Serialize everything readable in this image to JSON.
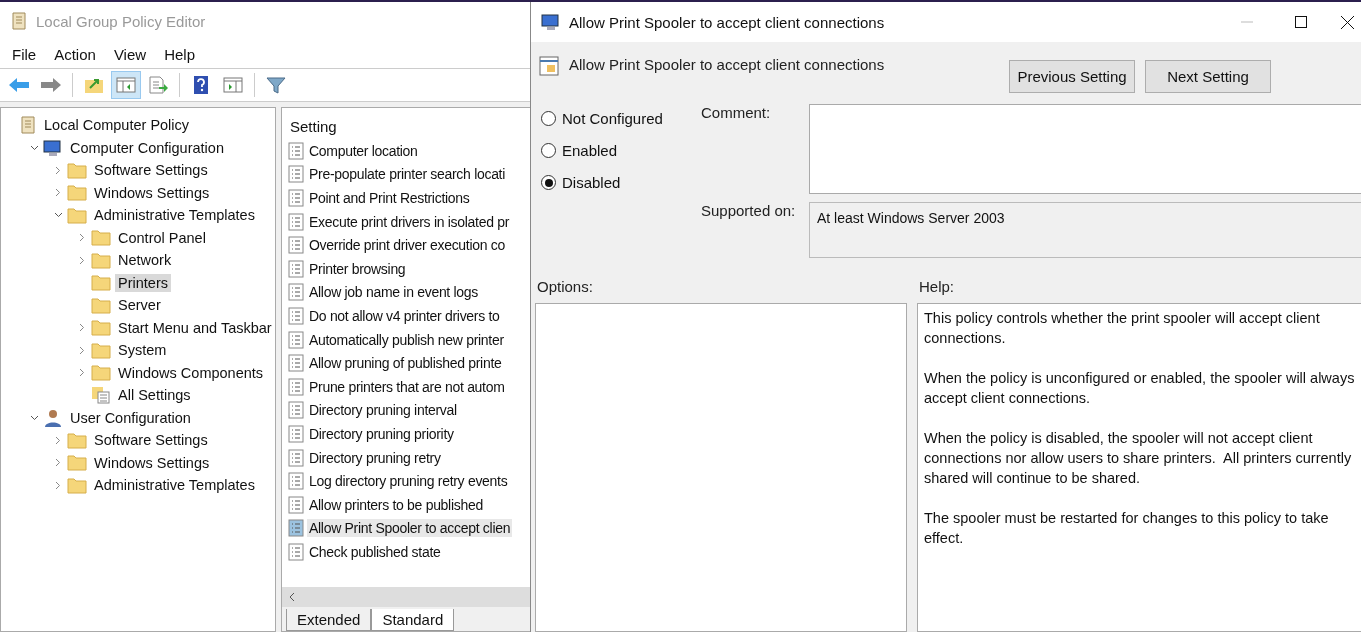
{
  "main_window": {
    "title": "Local Group Policy Editor",
    "menu": [
      "File",
      "Action",
      "View",
      "Help"
    ],
    "toolbar": [
      {
        "kind": "back",
        "selected": false
      },
      {
        "kind": "forward",
        "selected": false
      },
      {
        "kind": "sep"
      },
      {
        "kind": "up",
        "selected": false
      },
      {
        "kind": "tree",
        "selected": true
      },
      {
        "kind": "export",
        "selected": false
      },
      {
        "kind": "sep"
      },
      {
        "kind": "help",
        "selected": false
      },
      {
        "kind": "pane",
        "selected": false
      },
      {
        "kind": "sep"
      },
      {
        "kind": "filter",
        "selected": false
      }
    ],
    "tree": [
      {
        "label": "Local Computer Policy",
        "kind": "policy",
        "selected": false,
        "children": [
          {
            "label": "Computer Configuration",
            "kind": "computer",
            "expanded": true,
            "selected": false,
            "children": [
              {
                "label": "Software Settings",
                "kind": "folder",
                "expanded": false,
                "selected": false
              },
              {
                "label": "Windows Settings",
                "kind": "folder",
                "expanded": false,
                "selected": false
              },
              {
                "label": "Administrative Templates",
                "kind": "folder",
                "expanded": true,
                "selected": false,
                "children": [
                  {
                    "label": "Control Panel",
                    "kind": "folder",
                    "expanded": false,
                    "selected": false
                  },
                  {
                    "label": "Network",
                    "kind": "folder",
                    "expanded": false,
                    "selected": false
                  },
                  {
                    "label": "Printers",
                    "kind": "folder",
                    "selected": true
                  },
                  {
                    "label": "Server",
                    "kind": "folder",
                    "selected": false
                  },
                  {
                    "label": "Start Menu and Taskbar",
                    "kind": "folder",
                    "expanded": false,
                    "selected": false
                  },
                  {
                    "label": "System",
                    "kind": "folder",
                    "expanded": false,
                    "selected": false
                  },
                  {
                    "label": "Windows Components",
                    "kind": "folder",
                    "expanded": false,
                    "selected": false
                  },
                  {
                    "label": "All Settings",
                    "kind": "settings",
                    "selected": false
                  }
                ]
              }
            ]
          },
          {
            "label": "User Configuration",
            "kind": "user",
            "expanded": true,
            "selected": false,
            "children": [
              {
                "label": "Software Settings",
                "kind": "folder",
                "expanded": false,
                "selected": false
              },
              {
                "label": "Windows Settings",
                "kind": "folder",
                "expanded": false,
                "selected": false
              },
              {
                "label": "Administrative Templates",
                "kind": "folder",
                "expanded": false,
                "selected": false
              }
            ]
          }
        ]
      }
    ],
    "list": {
      "column": "Setting",
      "rows": [
        {
          "label": "Computer location",
          "selected": false
        },
        {
          "label": "Pre-populate printer search locati",
          "selected": false
        },
        {
          "label": "Point and Print Restrictions",
          "selected": false
        },
        {
          "label": "Execute print drivers in isolated pr",
          "selected": false
        },
        {
          "label": "Override print driver execution co",
          "selected": false
        },
        {
          "label": "Printer browsing",
          "selected": false
        },
        {
          "label": "Allow job name in event logs",
          "selected": false
        },
        {
          "label": "Do not allow v4 printer drivers to",
          "selected": false
        },
        {
          "label": "Automatically publish new printer",
          "selected": false
        },
        {
          "label": "Allow pruning of published printe",
          "selected": false
        },
        {
          "label": "Prune printers that are not autom",
          "selected": false
        },
        {
          "label": "Directory pruning interval",
          "selected": false
        },
        {
          "label": "Directory pruning priority",
          "selected": false
        },
        {
          "label": "Directory pruning retry",
          "selected": false
        },
        {
          "label": "Log directory pruning retry events",
          "selected": false
        },
        {
          "label": "Allow printers to be published",
          "selected": false
        },
        {
          "label": "Allow Print Spooler to accept clien",
          "selected": true
        },
        {
          "label": "Check published state",
          "selected": false
        }
      ]
    },
    "tabs": [
      {
        "label": "Extended",
        "selected": false
      },
      {
        "label": "Standard",
        "selected": true
      }
    ]
  },
  "dialog": {
    "title": "Allow Print Spooler to accept client connections",
    "heading": "Allow Print Spooler to accept client connections",
    "buttons": [
      "Previous Setting",
      "Next Setting"
    ],
    "options": [
      {
        "label": "Not Configured",
        "selected": false
      },
      {
        "label": "Enabled",
        "selected": false
      },
      {
        "label": "Disabled",
        "selected": true
      }
    ],
    "comment_label": "Comment:",
    "supported_label": "Supported on:",
    "supported_value": "At least Windows Server 2003",
    "options_label": "Options:",
    "help_label": "Help:",
    "help": [
      "This policy controls whether the print spooler will accept client connections.",
      "When the policy is unconfigured or enabled, the spooler will always accept client connections.",
      "When the policy is disabled, the spooler will not accept client connections nor allow users to share printers.  All printers currently shared will continue to be shared.",
      "The spooler must be restarted for changes to this policy to take effect."
    ]
  }
}
